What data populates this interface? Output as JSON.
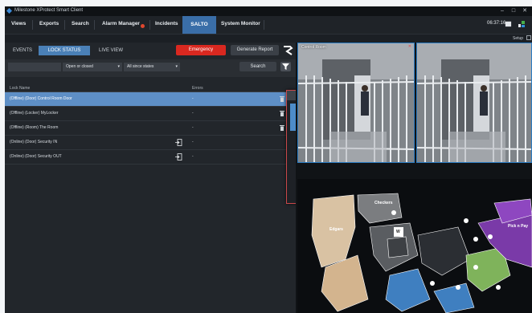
{
  "app": {
    "title": "Milestone XProtect Smart Client",
    "setup_label": "Setup"
  },
  "menu": {
    "items": [
      "Views",
      "Exports",
      "Search",
      "Alarm Manager",
      "Incidents",
      "SALTO",
      "System Monitor"
    ],
    "clock": "06:37:16"
  },
  "tabs": {
    "events": "EVENTS",
    "lock_status": "LOCK STATUS",
    "live_view": "LIVE VIEW"
  },
  "buttons": {
    "emergency": "Emergency",
    "generate_report": "Generate Report",
    "search": "Search"
  },
  "filters": {
    "search_placeholder": "",
    "state": "Open or closed",
    "since": "All since states"
  },
  "table": {
    "headers": {
      "lock_name": "Lock Name",
      "errors": "Errors"
    },
    "rows": [
      {
        "name": "(Offline) (Door) Control Room Door",
        "errors": "-",
        "selected": true,
        "icon": "",
        "trash": true
      },
      {
        "name": "(Offline) (Locker) MyLocker",
        "errors": "-",
        "selected": false,
        "icon": "",
        "trash": true
      },
      {
        "name": "(Offline) (Room) The Room",
        "errors": "-",
        "selected": false,
        "icon": "",
        "trash": true
      },
      {
        "name": "(Online) (Door) Security IN",
        "errors": "-",
        "selected": false,
        "icon": "door-exit-icon",
        "trash": false
      },
      {
        "name": "(Online) (Door) Security OUT",
        "errors": "-",
        "selected": false,
        "icon": "door-exit-icon",
        "trash": false
      }
    ]
  },
  "cameras": [
    {
      "title": "Control Room"
    },
    {
      "title": "Control Room"
    }
  ],
  "map": {
    "labels": [
      "Checkers",
      "Edgars",
      "Pick n Pay",
      "W"
    ],
    "map_title": "ND"
  },
  "colors": {
    "accent": "#4a80b7",
    "emergency": "#d92820",
    "selection": "#5e8fc6",
    "popup_border": "#c9484a"
  }
}
